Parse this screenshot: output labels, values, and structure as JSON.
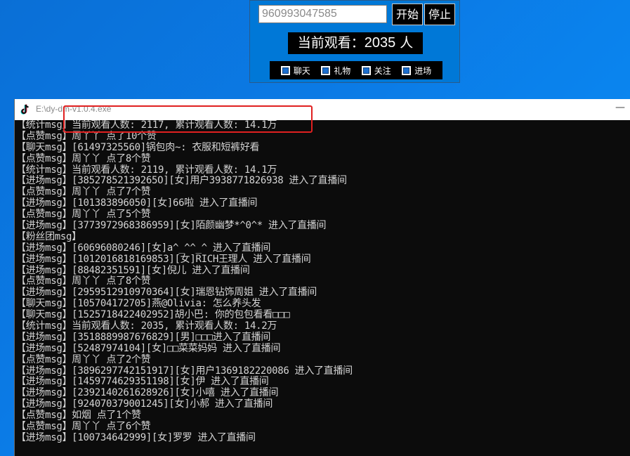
{
  "panel": {
    "room_id": "960993047585",
    "start_label": "开始",
    "stop_label": "停止",
    "viewers_prefix": "当前观看：",
    "viewers_count": "2035",
    "viewers_suffix": "人",
    "filters": [
      {
        "label": "聊天",
        "checked": true
      },
      {
        "label": "礼物",
        "checked": true
      },
      {
        "label": "关注",
        "checked": true
      },
      {
        "label": "进场",
        "checked": true
      }
    ]
  },
  "console": {
    "title": "E:\\dy-dm-v1.0.4.exe",
    "lines": [
      "【统计msg】当前观看人数: 2117, 累计观看人数: 14.1万",
      "【点赞msg】周丫丫 点了10个赞",
      "【聊天msg】[61497325560]锅包肉~: 衣服和短裤好看",
      "【点赞msg】周丫丫 点了8个赞",
      "【统计msg】当前观看人数: 2119, 累计观看人数: 14.1万",
      "【进场msg】[38527852139265O][女]用户3938771826938 进入了直播间",
      "【点赞msg】周丫丫 点了7个赞",
      "【进场msg】[101383896050][女]66啦 进入了直播间",
      "【点赞msg】周丫丫 点了5个赞",
      "【进场msg】[3773972968386959][女]陌颜幽梦*^0^* 进入了直播间",
      "【粉丝团msg】",
      "【进场msg】[60696080246][女]a^_^^_^ 进入了直播间",
      "【进场msg】[1012016818169853][女]RICH王理人 进入了直播间",
      "【进场msg】[88482351591][女]倪儿 进入了直播间",
      "【点赞msg】周丫丫 点了8个赞",
      "【进场msg】[2959512910970364][女]瑞恩钻饰周姐 进入了直播间",
      "【聊天msg】[105704172705]燕@Olivia: 怎么养头发",
      "【聊天msg】[1525718422402952]胡小巴: 你的包包看看□□□",
      "【统计msg】当前观看人数: 2035, 累计观看人数: 14.2万",
      "【进场msg】[3518889987676829][男]□□□进入了直播间",
      "【进场msg】[52487974104][女]□□菜菜妈妈 进入了直播间",
      "【点赞msg】周丫丫 点了2个赞",
      "【进场msg】[3896297742151917][女]用户1369182220086 进入了直播间",
      "【进场msg】[1459774629351198][女]伊 进入了直播间",
      "【进场msg】[2392140261628926][女]小嘻 进入了直播间",
      "【进场msg】[924070379001245][女]小郝 进入了直播间",
      "【点赞msg】如烟 点了1个赞",
      "【点赞msg】周丫丫 点了6个赞",
      "【进场msg】[100734642999][女]罗罗 进入了直播间"
    ]
  },
  "colors": {
    "panel_bg": "#0078d7",
    "console_bg": "#0c0c0c",
    "console_text": "#d4d4d4",
    "highlight": "#e02020"
  }
}
